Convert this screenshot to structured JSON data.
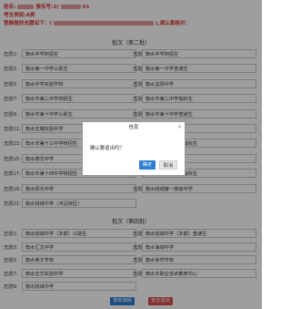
{
  "header": {
    "line1_prefix": "姓名:",
    "line1_mid": "报名号:2(",
    "line1_suffix": "61",
    "line2": "考生类别:A类",
    "line3_prefix": "登錄报的志愿如下：(",
    "line3_suffix": "),请认真核对："
  },
  "section1": {
    "title": "批次（第二批）",
    "rows": [
      {
        "l_label": "志愿1：",
        "l_value": "衡水中学阿招生",
        "r_label": "志愿2：",
        "r_value": "衡水中学阿招生"
      },
      {
        "l_label": "志愿3：",
        "l_value": "衡水第一中学公助生",
        "r_label": "志愿4：",
        "r_value": "衡水第一中学普通生"
      },
      {
        "l_label": "志愿5：",
        "l_value": "衡水中学实验学校",
        "r_label": "志愿6：",
        "r_value": "衡水溢阳中学"
      },
      {
        "l_label": "志愿7：",
        "l_value": "衡水市第二中学统招生",
        "r_label": "志愿8：",
        "r_value": "衡水市第二中学指标生"
      },
      {
        "l_label": "志愿9：",
        "l_value": "衡水市第十中学公助生",
        "r_label": "志愿10：",
        "r_value": "衡水市第十中学普通生"
      },
      {
        "l_label": "志愿11：",
        "l_value": "衡水志臻实验中学",
        "r_label": "志愿12：",
        "r_value": "衡水市区志臻中学"
      },
      {
        "l_label": "志愿13：",
        "l_value": "衡水市第十三中学统招生",
        "r_label": "志愿14：",
        "r_value": "衡水市第十三中学指标生"
      },
      {
        "l_label": "志愿15：",
        "l_value": "衡水德华中学",
        "r_label": "志愿16：",
        "r_value": "衡水德华中学"
      },
      {
        "l_label": "志愿17：",
        "l_value": "衡水市第十四中学统招生",
        "r_label": "志愿18：",
        "r_value": "衡水市第十四中学指标生"
      },
      {
        "l_label": "志愿19：",
        "l_value": "衡水阳光中学",
        "r_label": "志愿20：",
        "r_value": "衡水桃城第一高级中学"
      },
      {
        "l_label": "志愿21：",
        "l_value": "衡水桃城中学（河沿校区）",
        "r_label": "",
        "r_value": ""
      }
    ]
  },
  "section2": {
    "title": "批次（第四批）",
    "rows": [
      {
        "l_label": "志愿1：",
        "l_value": "衡水桃城中学（本部）公助生",
        "r_label": "志愿2：",
        "r_value": "衡水桃城中学（本部）普通生"
      },
      {
        "l_label": "志愿3：",
        "l_value": "衡水汇文中学",
        "r_label": "志愿4：",
        "r_value": "衡水海城中学"
      },
      {
        "l_label": "志愿5：",
        "l_value": "衡水英才学校",
        "r_label": "志愿6：",
        "r_value": "衡水崇然学校"
      },
      {
        "l_label": "志愿7：",
        "l_value": "衡水志华实验中学",
        "r_label": "志愿8：",
        "r_value": "衡水市职业技术教育中心"
      },
      {
        "l_label": "志愿9：",
        "l_value": "衡水桃城中学",
        "r_label": "",
        "r_value": ""
      }
    ]
  },
  "buttons": {
    "refill": "重新填报",
    "safe_exit": "安全退出"
  },
  "dialog": {
    "title": "信息",
    "message": "确认要退出吗？",
    "ok": "确定",
    "cancel": "取消",
    "close": "×"
  },
  "colors": {
    "header_red": "#dd3333",
    "primary_blue": "#2d7dd2",
    "danger_red": "#d9534f"
  }
}
